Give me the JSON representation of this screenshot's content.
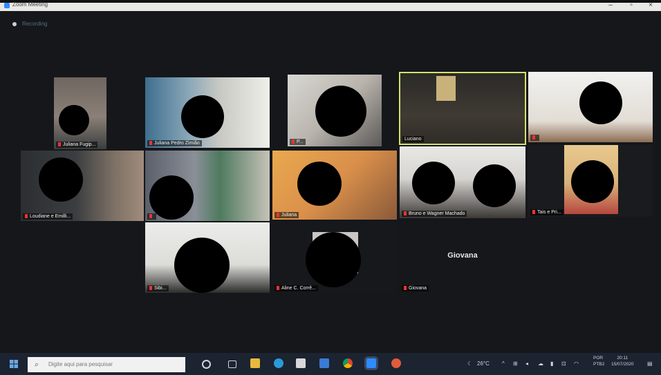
{
  "window": {
    "title": "Zoom Meeting",
    "controls": {
      "minimize": "–",
      "maximize": "▫",
      "close": "×"
    }
  },
  "meeting": {
    "recording_label": "Recording"
  },
  "participants": [
    {
      "name": "Juliana Fugip..."
    },
    {
      "name": "Juliana Pedro Zimião"
    },
    {
      "name": "P..."
    },
    {
      "name": "Luciano"
    },
    {
      "name": ""
    },
    {
      "name": "Loudiane e Emilli..."
    },
    {
      "name": ""
    },
    {
      "name": "Juliana"
    },
    {
      "name": "Bruno e Wagner Machado"
    },
    {
      "name": "Tais e Pri..."
    },
    {
      "name": "Sibi..."
    },
    {
      "name": "Aline C. Corrê..."
    },
    {
      "name": "Giovana",
      "display_name": "Giovana"
    }
  ],
  "taskbar": {
    "search_placeholder": "Digite aqui para pesquisar",
    "icons": [
      "task-view",
      "file-explorer",
      "edge",
      "store",
      "mail",
      "chrome",
      "zoom",
      "app"
    ],
    "tray": {
      "weather": "26°C",
      "language": "POR",
      "language_sub": "PTB2",
      "time": "20:11",
      "date": "15/07/2020"
    }
  },
  "colors": {
    "background": "#15171b",
    "active_speaker_border": "#d7e16a",
    "taskbar": "#1c2331"
  }
}
